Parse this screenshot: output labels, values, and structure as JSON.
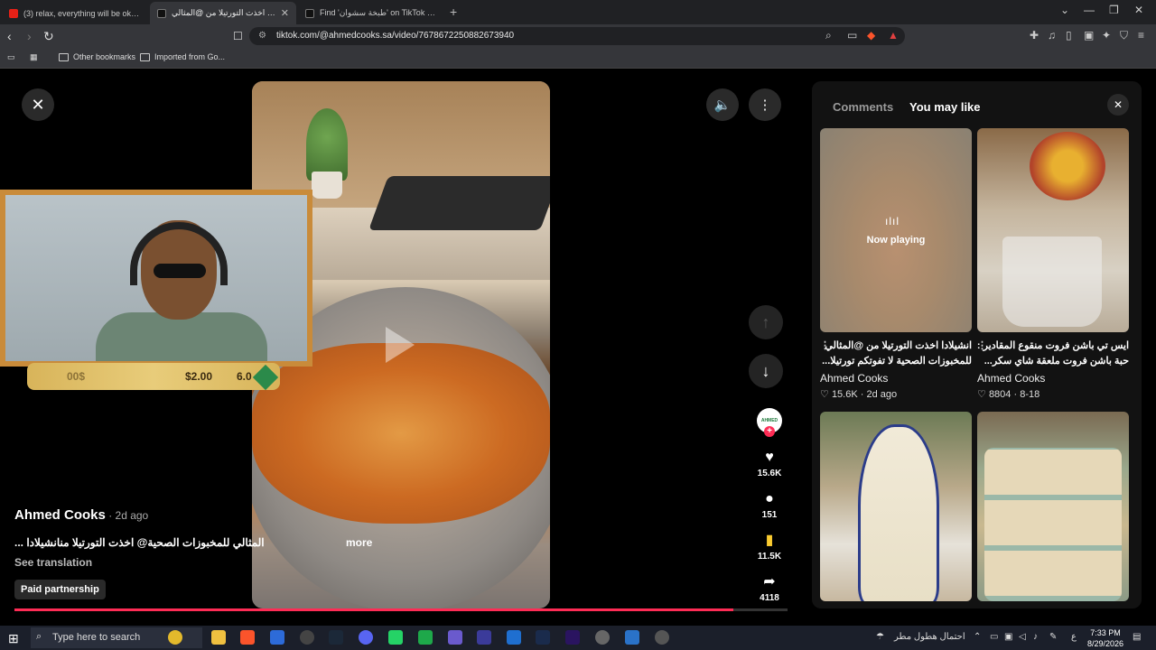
{
  "browser": {
    "tabs": [
      {
        "title": "(3) relax, everything will be okay... (m",
        "active": false
      },
      {
        "title": "انشيلادا اخذت التورتيلا من @المثالي",
        "active": true
      },
      {
        "title": "Find 'طبخة سشوان' on TikTok | TikTok",
        "active": false
      }
    ],
    "url": "tiktok.com/@ahmedcooks.sa/video/7678672250882673940",
    "bookmarks": {
      "other": "Other bookmarks",
      "imported": "Imported from Go..."
    }
  },
  "overlay": {
    "bar_dim": "00$",
    "bar_amount": "$2.00",
    "bar_extra": "6.0"
  },
  "video": {
    "more_label": "more",
    "author": "Ahmed Cooks",
    "time": " · 2d ago",
    "caption": "... المثالي للمخبوزات الصحية@ اخذت التورتيلا منانشيلادا",
    "see_translation": "See translation",
    "paid_partnership": "Paid partnership",
    "progress": 0.93,
    "avatar_text": "AHMED"
  },
  "actions": {
    "likes": "15.6K",
    "comments": "151",
    "saves": "11.5K",
    "shares": "4118"
  },
  "panel": {
    "tabs": {
      "comments": "Comments",
      "you_may_like": "You may like"
    },
    "cards": [
      {
        "title": "انشيلادا اخذت التورتيلا من @المثالي للمخبوزات الصحية لا تفوتكم تورتيلا...",
        "line1": "انشيلادا اخذت التورتيلا من @المثالي",
        "line2": "للمخبوزات الصحية لا تفوتكم تورتيلا...",
        "author": "Ahmed Cooks",
        "likes": "15.6K",
        "time": "2d ago",
        "now_playing": "Now playing"
      },
      {
        "line1": "ايس تي باشن فروت منقوع المقادير :",
        "line2": "حبة باشن فروت ملعقة شاي سكر...",
        "author": "Ahmed Cooks",
        "likes": "8804",
        "time": "8-18"
      }
    ]
  },
  "taskbar": {
    "search_placeholder": "Type here to search",
    "weather": "احتمال هطول مطر",
    "lang": "ع",
    "time": "7:33 PM",
    "date": "8/29/2026"
  },
  "colors": {
    "accent": "#fe2c55",
    "save": "#facb30"
  }
}
